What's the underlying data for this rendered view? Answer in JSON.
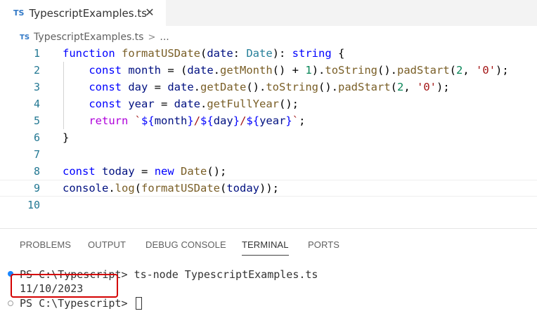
{
  "tab": {
    "badge": "TS",
    "title": "TypescriptExamples.ts",
    "close_glyph": "✕"
  },
  "breadcrumb": {
    "badge": "TS",
    "file": "TypescriptExamples.ts",
    "separator": ">",
    "more": "..."
  },
  "editor": {
    "line_numbers": [
      "1",
      "2",
      "3",
      "4",
      "5",
      "6",
      "7",
      "8",
      "9",
      "10"
    ],
    "code_lines": [
      "function formatUSDate(date: Date): string {",
      "    const month = (date.getMonth() + 1).toString().padStart(2, '0');",
      "    const day = date.getDate().toString().padStart(2, '0');",
      "    const year = date.getFullYear();",
      "    return `${month}/${day}/${year}`;",
      "}",
      "",
      "const today = new Date();",
      "console.log(formatUSDate(today));",
      ""
    ]
  },
  "panel": {
    "tabs": [
      "PROBLEMS",
      "OUTPUT",
      "DEBUG CONSOLE",
      "TERMINAL",
      "PORTS"
    ],
    "active_tab": "TERMINAL"
  },
  "terminal": {
    "prompt": "PS C:\\Typescript>",
    "command": "ts-node TypescriptExamples.ts",
    "output": "11/10/2023",
    "prompt2": "PS C:\\Typescript>"
  },
  "colors": {
    "accent": "#3178c6",
    "highlight": "#d40000",
    "line_number": "#237893"
  }
}
